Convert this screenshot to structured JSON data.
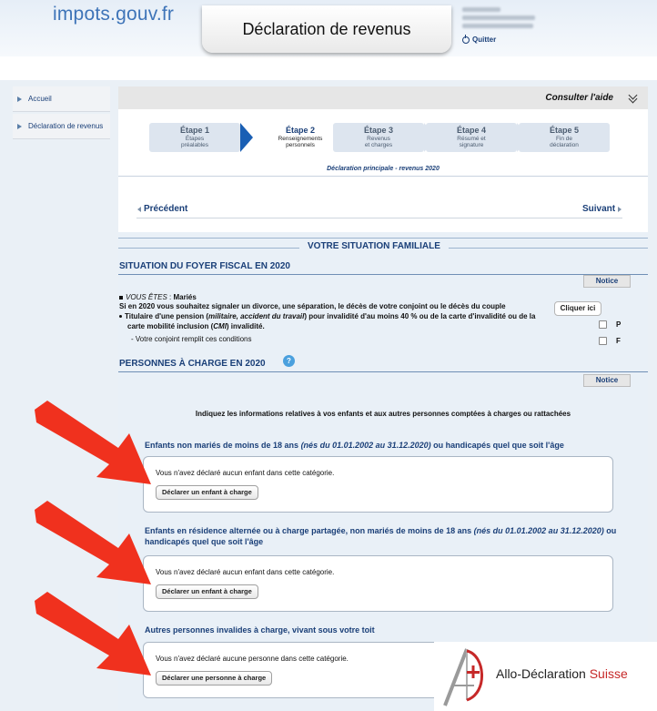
{
  "header": {
    "logo_text": "impots.gouv.fr",
    "title": "Déclaration de revenus",
    "quit_label": "Quitter"
  },
  "sidebar": {
    "items": [
      {
        "label": "Accueil"
      },
      {
        "label": "Déclaration de revenus"
      }
    ]
  },
  "help_bar": {
    "label": "Consulter l'aide"
  },
  "steps": [
    {
      "title": "Étape 1",
      "line1": "Étapes",
      "line2": "préalables",
      "active": false
    },
    {
      "title": "Étape 2",
      "line1": "Renseignements",
      "line2": "personnels",
      "active": true
    },
    {
      "title": "Étape 3",
      "line1": "Revenus",
      "line2": "et charges",
      "active": false
    },
    {
      "title": "Étape 4",
      "line1": "Résumé et",
      "line2": "signature",
      "active": false
    },
    {
      "title": "Étape 5",
      "line1": "Fin de",
      "line2": "déclaration",
      "active": false
    }
  ],
  "declaration_subtitle": "Déclaration principale - revenus 2020",
  "nav": {
    "prev_label": "Précédent",
    "next_label": "Suivant"
  },
  "form": {
    "section_title": "VOTRE SITUATION FAMILIALE",
    "foyer_title": "SITUATION DU FOYER FISCAL EN 2020",
    "notice_label": "Notice",
    "vous_etes_label": "VOUS ÊTES",
    "vous_etes_value": "Mariés",
    "change_text": "Si en 2020 vous souhaitez signaler un divorce, une séparation, le décès de votre conjoint ou le décès du couple",
    "cliquer_label": "Cliquer ici",
    "invalid_line_a": "Titulaire d'une pension (",
    "invalid_line_a_italic": "militaire, accident du travail",
    "invalid_line_a_rest": ") pour invalidité d'au moins 40 % ou de la carte d'invalidité ou de la",
    "invalid_line_b_pre": "carte mobilité inclusion (",
    "invalid_line_b_cmi": "CMI",
    "invalid_line_b_post": ") invalidité.",
    "conjoint_line": "- Votre conjoint remplit ces conditions",
    "checkbox_p": "P",
    "checkbox_f": "F",
    "persons_title": "PERSONNES À CHARGE EN 2020",
    "persons_intro": "Indiquez les informations relatives à vos enfants et aux autres personnes comptées à charges ou rattachées",
    "categories": [
      {
        "title_pre": "Enfants non mariés de moins de 18 ans ",
        "title_italic": "(nés du 01.01.2002 au 31.12.2020)",
        "title_post": " ou handicapés quel que soit l'âge",
        "message": "Vous n'avez déclaré aucun enfant dans cette catégorie.",
        "button": "Déclarer un enfant à charge"
      },
      {
        "title_pre": "Enfants en résidence alternée ou à charge partagée, non mariés de moins de 18 ans ",
        "title_italic": "(nés du 01.01.2002 au 31.12.2020)",
        "title_post": " ou handicapés quel que soit l'âge",
        "message": "Vous n'avez déclaré aucun enfant dans cette catégorie.",
        "button": "Déclarer un enfant à charge"
      },
      {
        "title_pre": "Autres personnes invalides à charge, vivant sous votre toit",
        "title_italic": "",
        "title_post": "",
        "message": "Vous n'avez déclaré aucune personne dans cette catégorie.",
        "button": "Déclarer une personne à charge"
      }
    ]
  },
  "watermark": {
    "brand": "Allo-Déclaration",
    "brand_suffix": "Suisse"
  },
  "colors": {
    "brand_blue": "#1a3f78",
    "logo_blue": "#3e74b8",
    "arrow_red": "#f0311e",
    "panel_bg": "#e9f0f7"
  }
}
